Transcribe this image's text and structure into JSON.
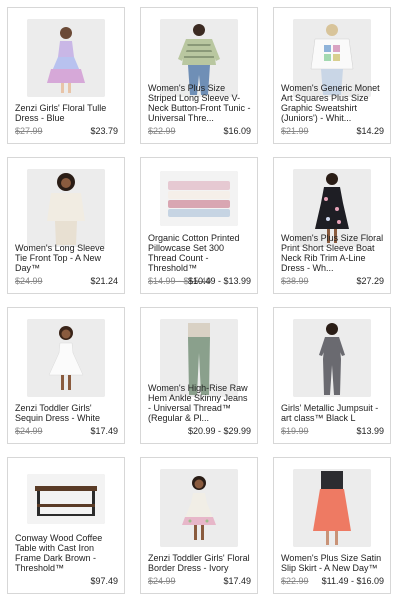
{
  "colors": {
    "card_border": "#d7d7d7",
    "thumb_bg": "#e9e9e9",
    "price": "#222222",
    "old_price": "#888888"
  },
  "products": [
    {
      "name": "Zenzi Girls' Floral Tulle Dress - Blue",
      "old_price": "$27.99",
      "price": "$23.79",
      "image": "girl-floral-tulle-dress"
    },
    {
      "name": "Women's Plus Size Striped Long Sleeve V-Neck Button-Front Tunic - Universal Thre...",
      "old_price": "$22.99",
      "price": "$16.09",
      "image": "woman-striped-tunic"
    },
    {
      "name": "Women's Generic Monet Art Squares Plus Size Graphic Sweatshirt (Juniors') - Whit...",
      "old_price": "$21.99",
      "price": "$14.29",
      "image": "woman-white-sweatshirt"
    },
    {
      "name": "Women's Long Sleeve Tie Front Top - A New Day™",
      "old_price": "$24.99",
      "price": "$21.24",
      "image": "woman-cream-top"
    },
    {
      "name": "Organic Cotton Printed Pillowcase Set 300 Thread Count - Threshold™",
      "old_price": "$14.99 - $15.49",
      "price": "$10.49 - $13.99",
      "image": "pillowcase-stack"
    },
    {
      "name": "Women's Plus Size Floral Print Short Sleeve Boat Neck Rib Trim A-Line Dress - Wh...",
      "old_price": "$38.99",
      "price": "$27.29",
      "image": "woman-black-floral-dress"
    },
    {
      "name": "Zenzi Toddler Girls' Sequin Dress - White",
      "old_price": "$24.99",
      "price": "$17.49",
      "image": "toddler-white-dress"
    },
    {
      "name": "Women's High-Rise Raw Hem Ankle Skinny Jeans - Universal Thread™ (Regular & Pl...",
      "old_price": "",
      "price": "$20.99 - $29.99",
      "image": "woman-green-jeans"
    },
    {
      "name": "Girls' Metallic Jumpsuit - art class™ Black L",
      "old_price": "$19.99",
      "price": "$13.99",
      "image": "girl-black-jumpsuit"
    },
    {
      "name": "Conway Wood Coffee Table with Cast Iron Frame Dark Brown - Threshold™",
      "old_price": "",
      "price": "$97.49",
      "image": "coffee-table"
    },
    {
      "name": "Zenzi Toddler Girls' Floral Border Dress - Ivory",
      "old_price": "$24.99",
      "price": "$17.49",
      "image": "toddler-floral-dress"
    },
    {
      "name": "Women's Plus Size Satin Slip Skirt - A New Day™",
      "old_price": "$22.99",
      "price": "$11.49 - $16.09",
      "image": "woman-coral-skirt"
    }
  ]
}
